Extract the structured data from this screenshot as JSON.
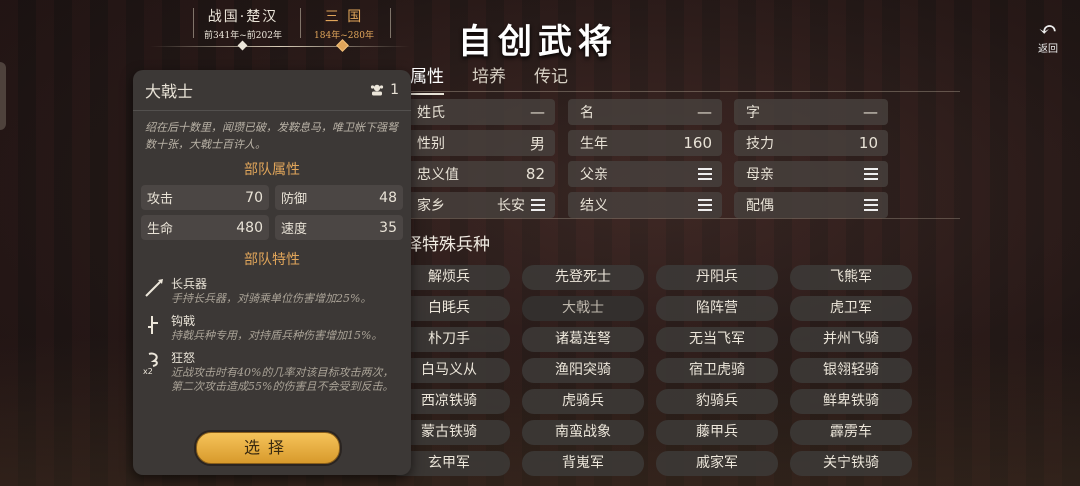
{
  "eras": [
    {
      "name": "战国·楚汉",
      "range": "前341年~前202年"
    },
    {
      "name": "三 国",
      "range": "184年~280年"
    }
  ],
  "title": "自创武将",
  "back_label": "返回",
  "tabs": [
    "属性",
    "培养",
    "传记"
  ],
  "attributes": {
    "surname": {
      "label": "姓氏",
      "value": "—"
    },
    "name": {
      "label": "名",
      "value": "—"
    },
    "courtesy": {
      "label": "字",
      "value": "—"
    },
    "gender": {
      "label": "性别",
      "value": "男"
    },
    "birth_year": {
      "label": "生年",
      "value": "160"
    },
    "skill": {
      "label": "技力",
      "value": "10"
    },
    "loyalty": {
      "label": "忠义值",
      "value": "82"
    },
    "father": {
      "label": "父亲"
    },
    "mother": {
      "label": "母亲"
    },
    "hometown": {
      "label": "家乡",
      "value": "长安"
    },
    "sworn": {
      "label": "结义"
    },
    "spouse": {
      "label": "配偶"
    }
  },
  "special_section_title": "择特殊兵种",
  "units": [
    [
      "解烦兵",
      "先登死士",
      "丹阳兵",
      "飞熊军"
    ],
    [
      "白眊兵",
      "大戟士",
      "陷阵营",
      "虎卫军"
    ],
    [
      "朴刀手",
      "诸葛连弩",
      "无当飞军",
      "并州飞骑"
    ],
    [
      "白马义从",
      "渔阳突骑",
      "宿卫虎骑",
      "银翎轻骑"
    ],
    [
      "西凉铁骑",
      "虎骑兵",
      "豹骑兵",
      "鲜卑铁骑"
    ],
    [
      "蒙古铁骑",
      "南蛮战象",
      "藤甲兵",
      "霹雳车"
    ],
    [
      "玄甲军",
      "背嵬军",
      "戚家军",
      "关宁铁骑"
    ]
  ],
  "selected_unit": "大戟士",
  "panel": {
    "unit_name": "大戟士",
    "count": "1",
    "description": "绍在后十数里，闻瓒已破，发鞍息马，唯卫帐下强弩数十张，大戟士百许人。",
    "stats_title": "部队属性",
    "stats": [
      {
        "label": "攻击",
        "value": "70"
      },
      {
        "label": "防御",
        "value": "48"
      },
      {
        "label": "生命",
        "value": "480"
      },
      {
        "label": "速度",
        "value": "35"
      }
    ],
    "traits_title": "部队特性",
    "traits": [
      {
        "name": "长兵器",
        "desc": "手持长兵器，对骑乘单位伤害增加25%。",
        "icon": "spear-icon"
      },
      {
        "name": "钩戟",
        "desc": "持戟兵种专用，对持盾兵种伤害增加15%。",
        "icon": "halberd-icon"
      },
      {
        "name": "狂怒",
        "desc": "近战攻击时有40%的几率对该目标攻击两次，第二次攻击造成55%的伤害且不会受到反击。",
        "icon": "rage-icon",
        "badge": "x2"
      }
    ],
    "select_label": "选择"
  },
  "colors": {
    "accent": "#e0a55a",
    "button": "#f0b949"
  }
}
